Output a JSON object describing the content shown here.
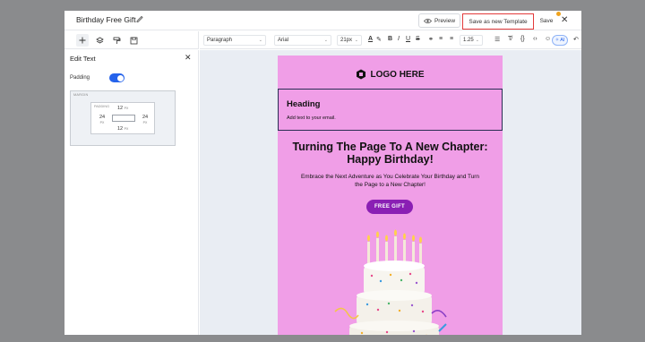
{
  "header": {
    "title": "Birthday Free Gift",
    "preview_label": "Preview",
    "save_template_label": "Save as new Template",
    "save_label": "Save",
    "close_glyph": "✕"
  },
  "left_panel": {
    "title": "Edit Text",
    "close_glyph": "✕",
    "padding_label": "Padding",
    "padding_enabled": true,
    "margin_label": "MARGIN",
    "padding_box_label": "PADDING",
    "padding": {
      "top": "12",
      "bottom": "12",
      "left": "24",
      "right": "24",
      "unit": "PX"
    }
  },
  "format_bar": {
    "block_type": "Paragraph",
    "font": "Arial",
    "font_size": "21px",
    "line_height": "1.25",
    "ai_label": "AI"
  },
  "email": {
    "logo_text": "LOGO HERE",
    "heading": "Heading",
    "heading_subtext": "Add text to your email.",
    "main_title_line1": "Turning The Page To A New Chapter:",
    "main_title_line2": "Happy Birthday!",
    "body_line1": "Embrace the Next Adventure as You Celebrate Your Birthday and Turn",
    "body_line2": "the Page to a New Chapter!",
    "cta_label": "FREE GIFT"
  },
  "colors": {
    "email_bg": "#f09ee7",
    "cta_bg": "#8a1fb4",
    "toggle_on": "#2563eb",
    "highlight_border": "#e33b3b",
    "notification_dot": "#f0a31d",
    "canvas_bg": "#e9edf3"
  },
  "icons": {
    "title_edit": "pencil-icon",
    "preview": "eye-icon",
    "add_block": "plus-icon",
    "layers": "layers-icon",
    "paint": "paint-roller-icon",
    "save_disk": "floppy-disk-icon"
  }
}
